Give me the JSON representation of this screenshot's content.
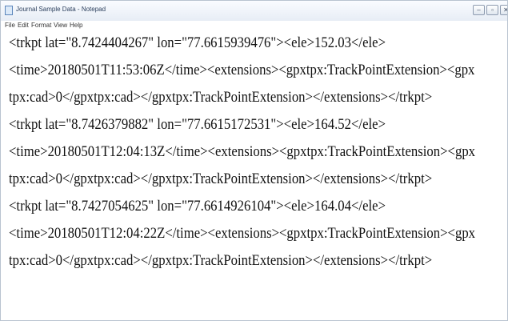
{
  "window": {
    "title": "Journal Sample Data - Notepad",
    "buttons": {
      "minimize": "–",
      "maximize": "▫",
      "close": "✕"
    }
  },
  "menu": [
    "File",
    "Edit",
    "Format",
    "View",
    "Help"
  ],
  "editor": {
    "lines": [
      "<trkpt lat=\"8.7424404267\" lon=\"77.6615939476\"><ele>152.03</ele>",
      "<time>20180501T11:53:06Z</time><extensions><gpxtpx:TrackPointExtension><gpx",
      "tpx:cad>0</gpxtpx:cad></gpxtpx:TrackPointExtension></extensions></trkpt>",
      "<trkpt lat=\"8.7426379882\" lon=\"77.6615172531\"><ele>164.52</ele>",
      "<time>20180501T12:04:13Z</time><extensions><gpxtpx:TrackPointExtension><gpx",
      "tpx:cad>0</gpxtpx:cad></gpxtpx:TrackPointExtension></extensions></trkpt>",
      "<trkpt lat=\"8.7427054625\" lon=\"77.6614926104\"><ele>164.04</ele>",
      "<time>20180501T12:04:22Z</time><extensions><gpxtpx:TrackPointExtension><gpx",
      "tpx:cad>0</gpxtpx:cad></gpxtpx:TrackPointExtension></extensions></trkpt>"
    ]
  }
}
